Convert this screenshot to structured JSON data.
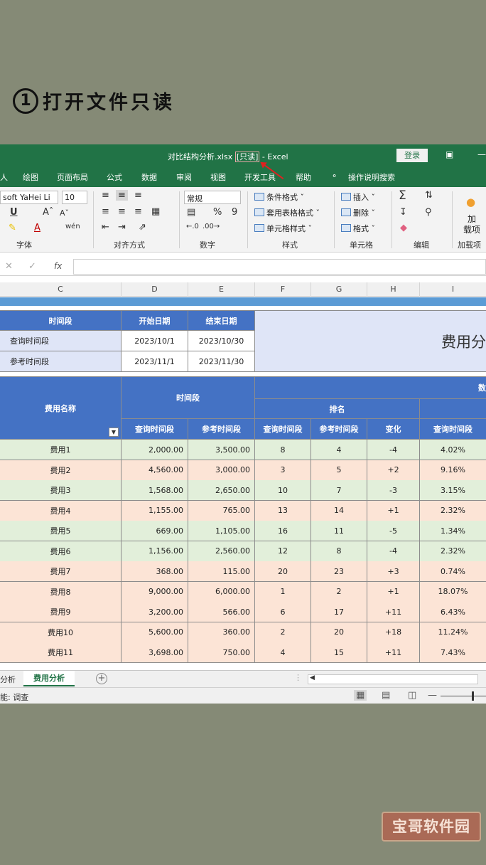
{
  "caption": {
    "num": "1",
    "text": "打开文件只读"
  },
  "titlebar": {
    "filename": "对比结构分析.xlsx",
    "readonly": "[只读]",
    "dash": "-",
    "app": "Excel",
    "login": "登录"
  },
  "menu": [
    "人",
    "绘图",
    "页面布局",
    "公式",
    "数据",
    "审阅",
    "视图",
    "开发工具",
    "帮助",
    "操作说明搜索"
  ],
  "ribbon": {
    "font_name": "soft YaHei Li",
    "font_size": "10",
    "number_format": "常规",
    "groups": [
      "字体",
      "对齐方式",
      "数字",
      "样式",
      "单元格",
      "编辑",
      "加载项"
    ],
    "style_cmds": [
      "条件格式",
      "套用表格格式",
      "单元格样式"
    ],
    "cell_cmds": [
      "插入",
      "删除",
      "格式"
    ],
    "addin": "加载项",
    "addin_top": "加",
    "addin_bottom": "载项",
    "percent": "%",
    "comma": "9"
  },
  "formula_bar": {
    "fx": "fx",
    "value": ""
  },
  "columns": [
    "C",
    "D",
    "E",
    "F",
    "G",
    "H",
    "I"
  ],
  "top_table": {
    "headers": [
      "时间段",
      "开始日期",
      "结束日期"
    ],
    "rows": [
      [
        "查询时间段",
        "2023/10/1",
        "2023/10/30"
      ],
      [
        "参考时间段",
        "2023/11/1",
        "2023/11/30"
      ]
    ],
    "side_title": "费用分"
  },
  "main_table": {
    "name_header": "费用名称",
    "period_header": "时间段",
    "data_header": "数",
    "rank_header": "排名",
    "sub_headers": [
      "查询时间段",
      "参考时间段",
      "查询时间段",
      "参考时间段",
      "变化",
      "查询时间段"
    ],
    "rows": [
      {
        "name": "费用1",
        "q": "2,000.00",
        "r": "3,500.00",
        "rq": "8",
        "rr": "4",
        "chg": "-4",
        "pct": "4.02%",
        "color": "green"
      },
      {
        "name": "费用2",
        "q": "4,560.00",
        "r": "3,000.00",
        "rq": "3",
        "rr": "5",
        "chg": "+2",
        "pct": "9.16%",
        "color": "pink"
      },
      {
        "name": "费用3",
        "q": "1,568.00",
        "r": "2,650.00",
        "rq": "10",
        "rr": "7",
        "chg": "-3",
        "pct": "3.15%",
        "color": "green"
      },
      {
        "name": "费用4",
        "q": "1,155.00",
        "r": "765.00",
        "rq": "13",
        "rr": "14",
        "chg": "+1",
        "pct": "2.32%",
        "color": "pink"
      },
      {
        "name": "费用5",
        "q": "669.00",
        "r": "1,105.00",
        "rq": "16",
        "rr": "11",
        "chg": "-5",
        "pct": "1.34%",
        "color": "green"
      },
      {
        "name": "费用6",
        "q": "1,156.00",
        "r": "2,560.00",
        "rq": "12",
        "rr": "8",
        "chg": "-4",
        "pct": "2.32%",
        "color": "green"
      },
      {
        "name": "费用7",
        "q": "368.00",
        "r": "115.00",
        "rq": "20",
        "rr": "23",
        "chg": "+3",
        "pct": "0.74%",
        "color": "pink"
      },
      {
        "name": "费用8",
        "q": "9,000.00",
        "r": "6,000.00",
        "rq": "1",
        "rr": "2",
        "chg": "+1",
        "pct": "18.07%",
        "color": "pink"
      },
      {
        "name": "费用9",
        "q": "3,200.00",
        "r": "566.00",
        "rq": "6",
        "rr": "17",
        "chg": "+11",
        "pct": "6.43%",
        "color": "pink"
      },
      {
        "name": "费用10",
        "q": "5,600.00",
        "r": "360.00",
        "rq": "2",
        "rr": "20",
        "chg": "+18",
        "pct": "11.24%",
        "color": "pink"
      },
      {
        "name": "费用11",
        "q": "3,698.00",
        "r": "750.00",
        "rq": "4",
        "rr": "15",
        "chg": "+11",
        "pct": "7.43%",
        "color": "pink"
      }
    ]
  },
  "sheet_tabs": {
    "prev": "分析",
    "active": "费用分析",
    "add": "+"
  },
  "status": {
    "text": "能: 调查"
  },
  "watermark": "宝哥软件园",
  "colors": {
    "excel_green": "#217346",
    "header_blue": "#4472c4",
    "row_green": "#e2efda",
    "row_pink": "#fce4d6",
    "lavender": "#dfe5f7"
  }
}
